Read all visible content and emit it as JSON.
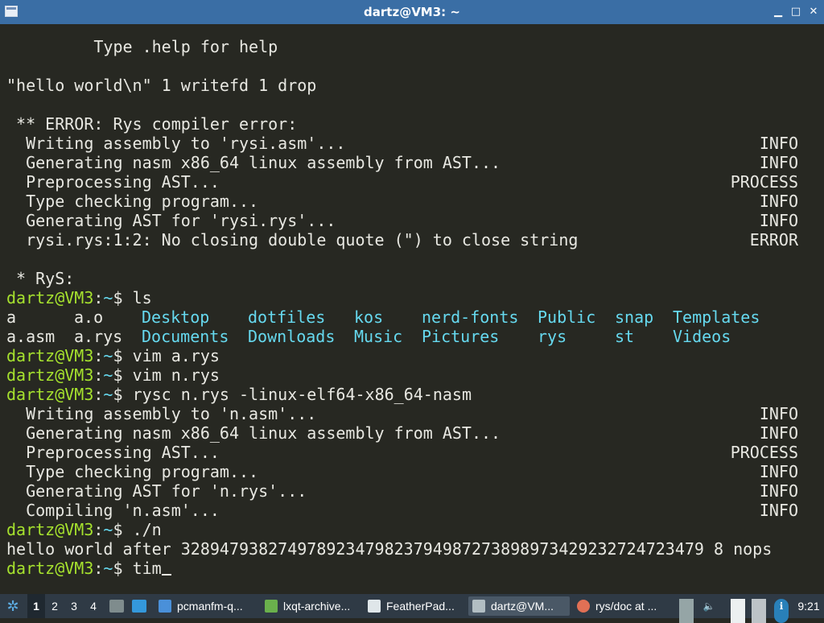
{
  "window": {
    "title": "dartz@VM3: ~",
    "buttons": {
      "minimize": "▁",
      "maximize": "□",
      "close": "✕"
    }
  },
  "terminal": {
    "banner": "         Type .help for help",
    "cmd_input": "\"hello world\\n\" 1 writefd 1 drop",
    "error_header": " ** ERROR: Rys compiler error:",
    "log1": [
      {
        "text": "  Writing assembly to 'rysi.asm'...",
        "status": "INFO"
      },
      {
        "text": "  Generating nasm x86_64 linux assembly from AST...",
        "status": "INFO"
      },
      {
        "text": "  Preprocessing AST...",
        "status": "PROCESS"
      },
      {
        "text": "  Type checking program...",
        "status": "INFO"
      },
      {
        "text": "  Generating AST for 'rysi.rys'...",
        "status": "INFO"
      },
      {
        "text": "  rysi.rys:1:2: No closing double quote (\") to close string",
        "status": "ERROR"
      }
    ],
    "rys_prompt": " * RyS:",
    "prompt_user": "dartz@VM3",
    "prompt_sep": ":",
    "prompt_dir": "~",
    "prompt_sym": "$ ",
    "commands": {
      "ls": "ls",
      "vim_a": "vim a.rys",
      "vim_n": "vim n.rys",
      "rysc": "rysc n.rys -linux-elf64-x86_64-nasm",
      "run": "./n",
      "current": "tim"
    },
    "ls_row1": {
      "files": [
        "a",
        "a.o"
      ],
      "dirs": [
        "Desktop",
        "dotfiles",
        "kos",
        "nerd-fonts",
        "Public",
        "snap",
        "Templates"
      ]
    },
    "ls_row2": {
      "files": [
        "a.asm",
        "a.rys"
      ],
      "dirs": [
        "Documents",
        "Downloads",
        "Music",
        "Pictures",
        "rys",
        "st",
        "Videos"
      ]
    },
    "log2": [
      {
        "text": "  Writing assembly to 'n.asm'...",
        "status": "INFO"
      },
      {
        "text": "  Generating nasm x86_64 linux assembly from AST...",
        "status": "INFO"
      },
      {
        "text": "  Preprocessing AST...",
        "status": "PROCESS"
      },
      {
        "text": "  Type checking program...",
        "status": "INFO"
      },
      {
        "text": "  Generating AST for 'n.rys'...",
        "status": "INFO"
      },
      {
        "text": "  Compiling 'n.asm'...",
        "status": "INFO"
      }
    ],
    "output": "hello world after 328947938274978923479823794987273898973429232724723479 8 nops"
  },
  "taskbar": {
    "workspaces": [
      "1",
      "2",
      "3",
      "4"
    ],
    "tasks": [
      {
        "label": "pcmanfm-q...",
        "color": "#4a90d9"
      },
      {
        "label": "lxqt-archive...",
        "color": "#6ab04c"
      },
      {
        "label": "FeatherPad...",
        "color": "#dfe6e9"
      },
      {
        "label": "dartz@VM...",
        "color": "#b2bec3"
      },
      {
        "label": "rys/doc at ...",
        "color": "#e17055"
      }
    ],
    "clock": "9:21"
  }
}
